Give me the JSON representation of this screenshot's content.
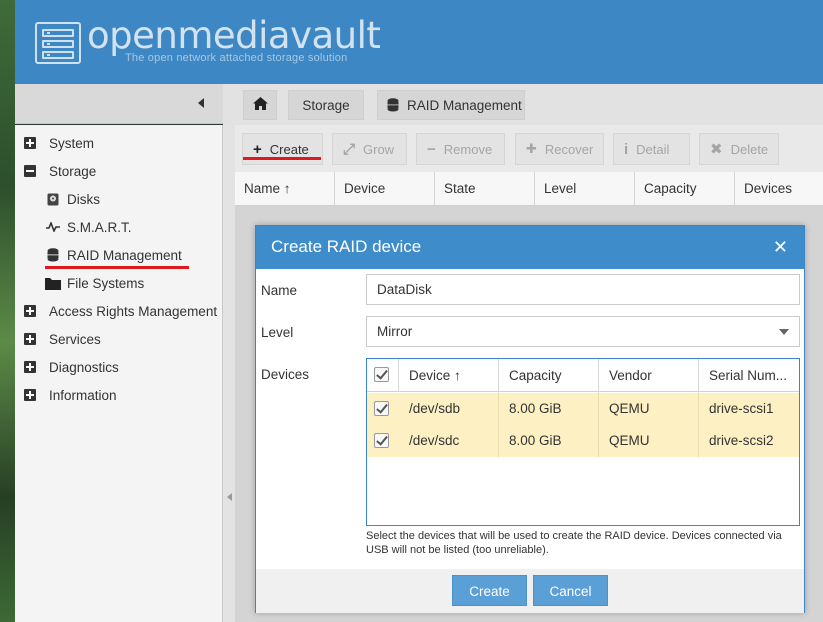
{
  "header": {
    "title": "openmediavault",
    "subtitle": "The open network attached storage solution"
  },
  "sidebar": {
    "items": [
      {
        "label": "System",
        "type": "group",
        "state": "collapsed"
      },
      {
        "label": "Storage",
        "type": "group",
        "state": "expanded"
      },
      {
        "label": "Disks",
        "type": "child",
        "icon": "disk-icon"
      },
      {
        "label": "S.M.A.R.T.",
        "type": "child",
        "icon": "pulse-icon"
      },
      {
        "label": "RAID Management",
        "type": "child",
        "icon": "database-icon",
        "selected": true
      },
      {
        "label": "File Systems",
        "type": "child",
        "icon": "folder-icon"
      },
      {
        "label": "Access Rights Management",
        "type": "group",
        "state": "collapsed"
      },
      {
        "label": "Services",
        "type": "group",
        "state": "collapsed"
      },
      {
        "label": "Diagnostics",
        "type": "group",
        "state": "collapsed"
      },
      {
        "label": "Information",
        "type": "group",
        "state": "collapsed"
      }
    ]
  },
  "breadcrumb": {
    "items": [
      "Storage",
      "RAID Management"
    ]
  },
  "toolbar": {
    "create": "Create",
    "grow": "Grow",
    "remove": "Remove",
    "recover": "Recover",
    "detail": "Detail",
    "delete": "Delete"
  },
  "grid": {
    "columns": [
      "Name",
      "Device",
      "State",
      "Level",
      "Capacity",
      "Devices"
    ]
  },
  "dialog": {
    "title": "Create RAID device",
    "name_label": "Name",
    "name_value": "DataDisk",
    "level_label": "Level",
    "level_value": "Mirror",
    "devices_label": "Devices",
    "device_columns": [
      "Device",
      "Capacity",
      "Vendor",
      "Serial Num..."
    ],
    "devices": [
      {
        "device": "/dev/sdb",
        "capacity": "8.00 GiB",
        "vendor": "QEMU",
        "serial": "drive-scsi1",
        "checked": true
      },
      {
        "device": "/dev/sdc",
        "capacity": "8.00 GiB",
        "vendor": "QEMU",
        "serial": "drive-scsi2",
        "checked": true
      }
    ],
    "hint": "Select the devices that will be used to create the RAID device. Devices connected via USB will not be listed (too unreliable).",
    "create_button": "Create",
    "cancel_button": "Cancel"
  },
  "colors": {
    "header": "#3c87c4",
    "dialog_header": "#3f8cca",
    "selected_row": "#fdf0c3",
    "annotation_underline": "#e0191e",
    "button": "#5a9fd6"
  }
}
